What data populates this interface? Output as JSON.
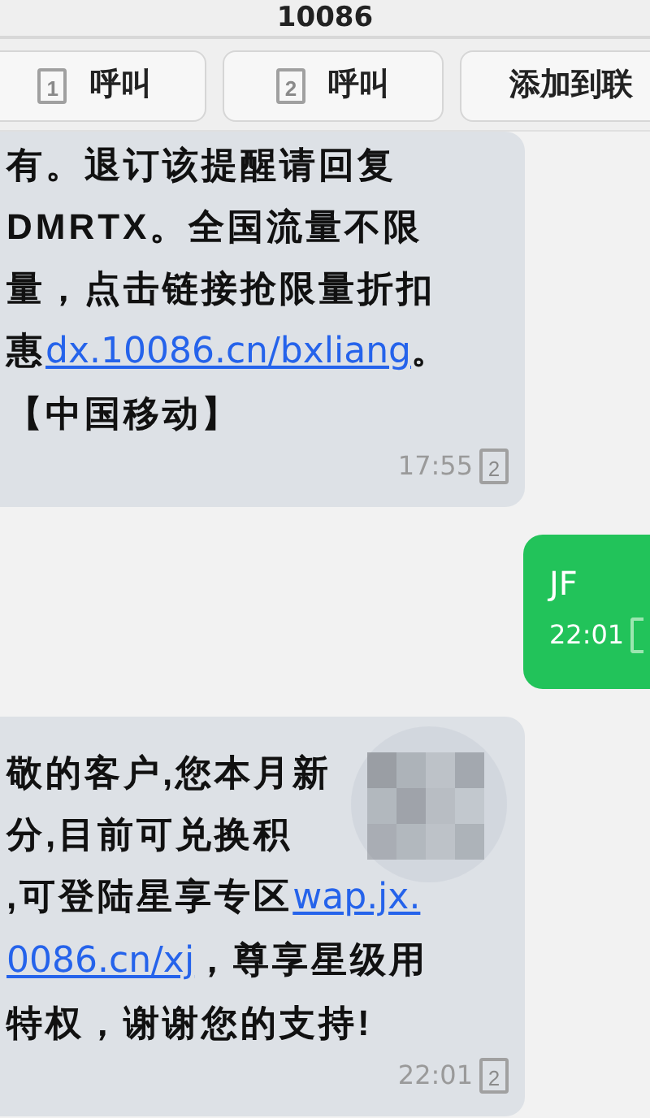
{
  "header": {
    "title": "10086"
  },
  "actions": [
    {
      "label": "呼叫",
      "sim": "1"
    },
    {
      "label": "呼叫",
      "sim": "2"
    },
    {
      "label": "添加到联"
    }
  ],
  "messages": [
    {
      "kind": "incoming",
      "lines": [
        [
          {
            "text": "有。退订该提醒请回复",
            "link": false
          }
        ],
        [
          {
            "text": "DMRTX。全国流量不限",
            "link": false
          }
        ],
        [
          {
            "text": "量，点击链接抢限量折扣",
            "link": false
          }
        ],
        [
          {
            "text": "惠",
            "link": false
          },
          {
            "text": "dx.10086.cn/bxliang",
            "link": true
          },
          {
            "text": "。",
            "link": false
          }
        ],
        [
          {
            "text": "【中国移动】",
            "link": false
          }
        ]
      ],
      "time": "17:55",
      "sim": "2",
      "redacted": false
    },
    {
      "kind": "outgoing",
      "lines": [
        [
          {
            "text": "JF",
            "link": false
          }
        ]
      ],
      "time": "22:01"
    },
    {
      "kind": "incoming",
      "lines": [
        [
          {
            "text": "敬的客户,您本月新",
            "link": false
          }
        ],
        [
          {
            "text": "分,目前可兑换积",
            "link": false
          }
        ],
        [
          {
            "text": ",可登陆星享专区",
            "link": false
          },
          {
            "text": "wap.jx.",
            "link": true
          }
        ],
        [
          {
            "text": "0086.cn/xj",
            "link": true
          },
          {
            "text": "，尊享星级用",
            "link": false
          }
        ],
        [
          {
            "text": "特权，谢谢您的支持!",
            "link": false
          }
        ]
      ],
      "time": "22:01",
      "sim": "2",
      "redacted": true
    }
  ]
}
